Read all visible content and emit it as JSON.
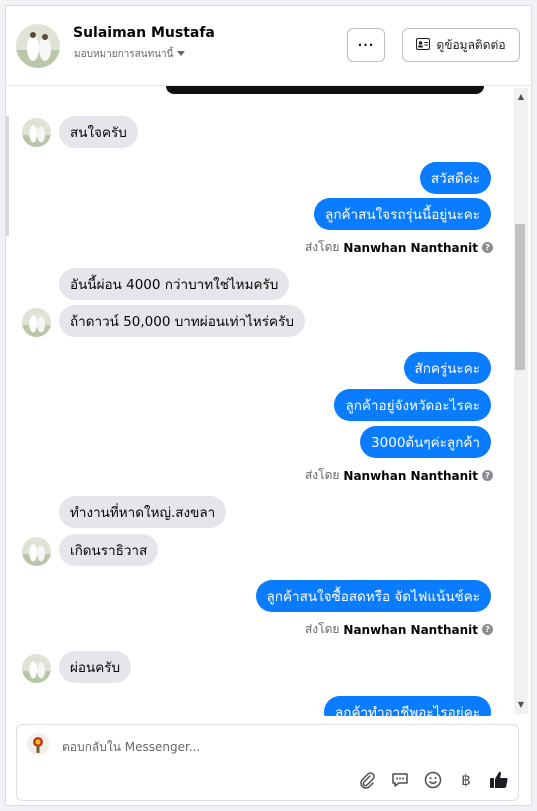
{
  "header": {
    "contact_name": "Sulaiman Mustafa",
    "assign_label": "มอบหมายการสนทนานี้",
    "more_label": "···",
    "view_contact_label": "ดูข้อมูลติดต่อ"
  },
  "messages": [
    {
      "dir": "in",
      "text": "สนใจครับ"
    },
    {
      "dir": "out",
      "text": "สวัสดีค่ะ"
    },
    {
      "dir": "out",
      "text": "ลูกค้าสนใจรถรุ่นนี้อยู่นะคะ"
    },
    {
      "dir": "in",
      "text": "อันนี้ผ่อน 4000 กว่าบาทใช่ไหมครับ"
    },
    {
      "dir": "in",
      "text": "ถ้าดาวน์ 50,000 บาทผ่อนเท่าไหร่ครับ"
    },
    {
      "dir": "out",
      "text": "สักครู่นะคะ"
    },
    {
      "dir": "out",
      "text": "ลูกค้าอยู่จังหวัดอะไรคะ"
    },
    {
      "dir": "out",
      "text": "3000ต้นๆค่ะลูกค้า"
    },
    {
      "dir": "in",
      "text": "ทำงานที่หาดใหญ่.สงขลา"
    },
    {
      "dir": "in",
      "text": "เกิดนราธิวาส"
    },
    {
      "dir": "out",
      "text": "ลูกค้าสนใจซื้อสดหรือ จัดไฟแน้นช์คะ"
    },
    {
      "dir": "in",
      "text": "ผ่อนครับ"
    },
    {
      "dir": "out",
      "text": "ลูกค้าทำอาชีพอะไรอยู่คะ"
    }
  ],
  "sent_by": {
    "prefix": "ส่งโดย",
    "agent": "Nanwhan Nanthanit"
  },
  "composer": {
    "placeholder": "ตอบกลับใน Messenger..."
  },
  "icons": {
    "attach": "paperclip-icon",
    "saved_reply": "chat-bubble-icon",
    "emoji": "smiley-icon",
    "currency": "baht-icon",
    "like": "thumbs-up-icon"
  },
  "colors": {
    "outgoing_bubble": "#0a7cff",
    "incoming_bubble": "#e4e6eb"
  }
}
